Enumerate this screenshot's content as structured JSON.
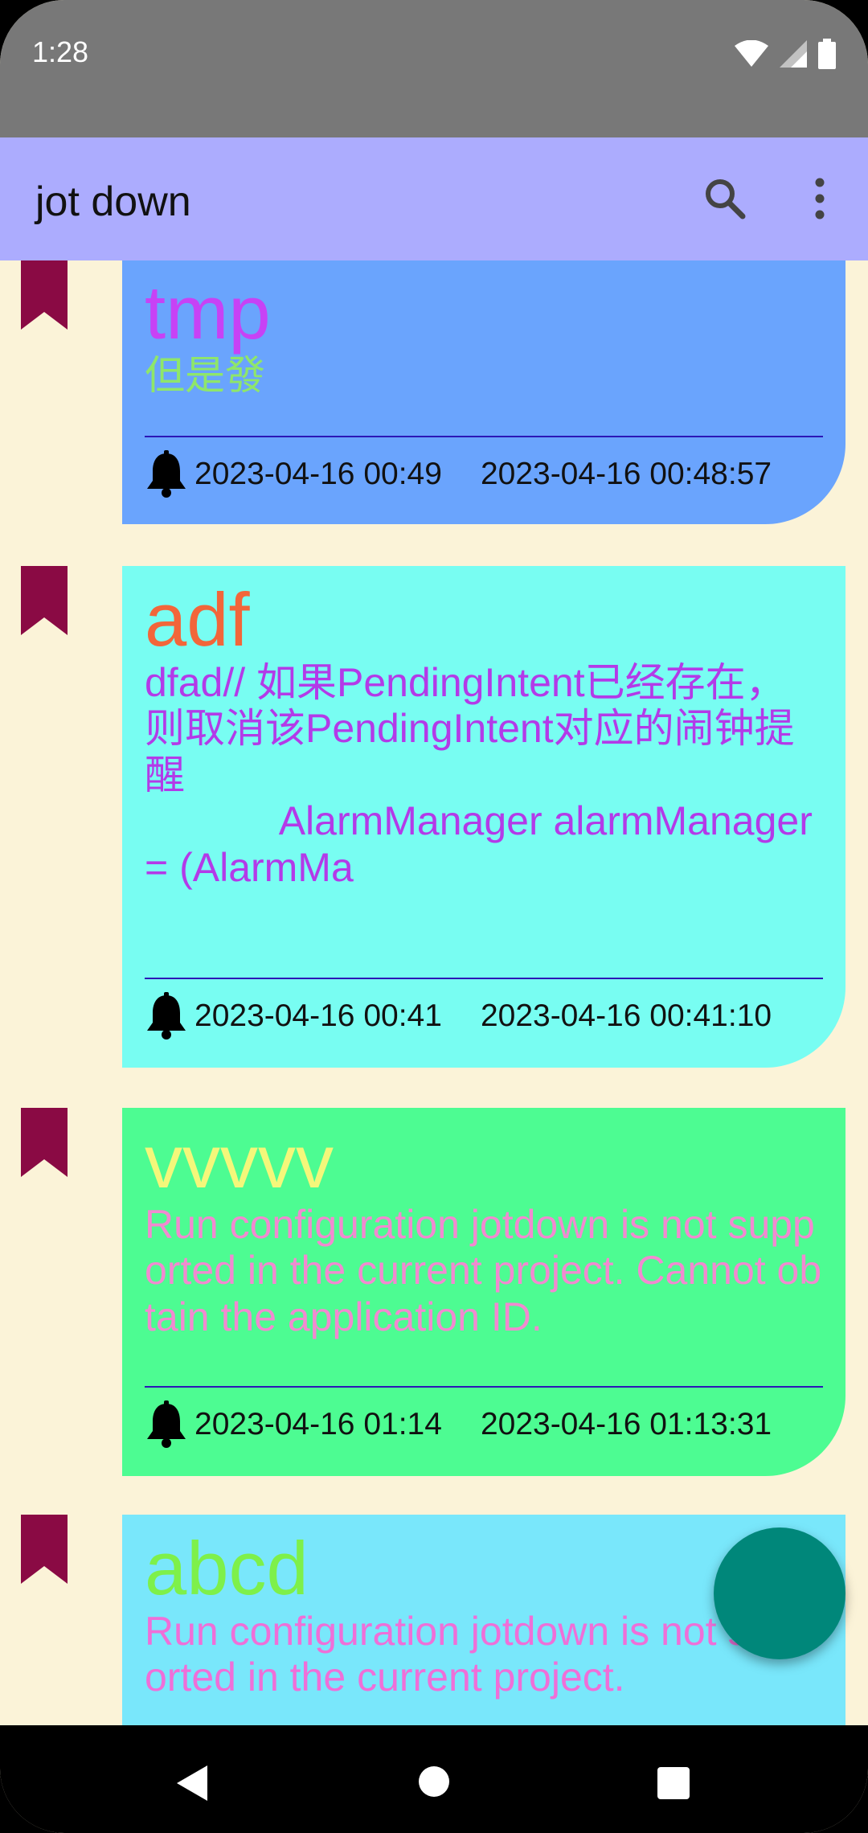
{
  "status_bar": {
    "time": "1:28"
  },
  "app_bar": {
    "title": "jot down",
    "search_icon": "search-icon",
    "menu_icon": "more-vert-icon"
  },
  "notes": [
    {
      "title": "tmp",
      "title_color": "#c742f5",
      "body": "但是發",
      "body_color": "#8fe66a",
      "card_color": "#6aa4fd",
      "alarm_time": "2023-04-16 00:49",
      "created_time": "2023-04-16 00:48:57"
    },
    {
      "title": "adf",
      "title_color": "#f2663a",
      "body": "dfad// 如果PendingIntent已经存在，则取消该PendingIntent对应的闹钟提醒\n            AlarmManager alarmManager = (AlarmMa",
      "body_color": "#b33ae8",
      "card_color": "#78fdf2",
      "alarm_time": "2023-04-16 00:41",
      "created_time": "2023-04-16 00:41:10"
    },
    {
      "title": "vvvvv",
      "title_color": "#f4f77a",
      "body": "Run configuration jotdown is not supported in the current project. Cannot obtain the application ID.",
      "body_color": "#f18ad0",
      "card_color": "#4dfc92",
      "alarm_time": "2023-04-16 01:14",
      "created_time": "2023-04-16 01:13:31"
    },
    {
      "title": "abcd",
      "title_color": "#7ef04a",
      "body": "Run configuration jotdown is not supported in the current project.",
      "body_color": "#ef6fd8",
      "card_color": "#79e7fb"
    }
  ],
  "colors": {
    "bookmark": "#8a0a44",
    "fab": "#00877a",
    "divider": "#2b17b6"
  }
}
